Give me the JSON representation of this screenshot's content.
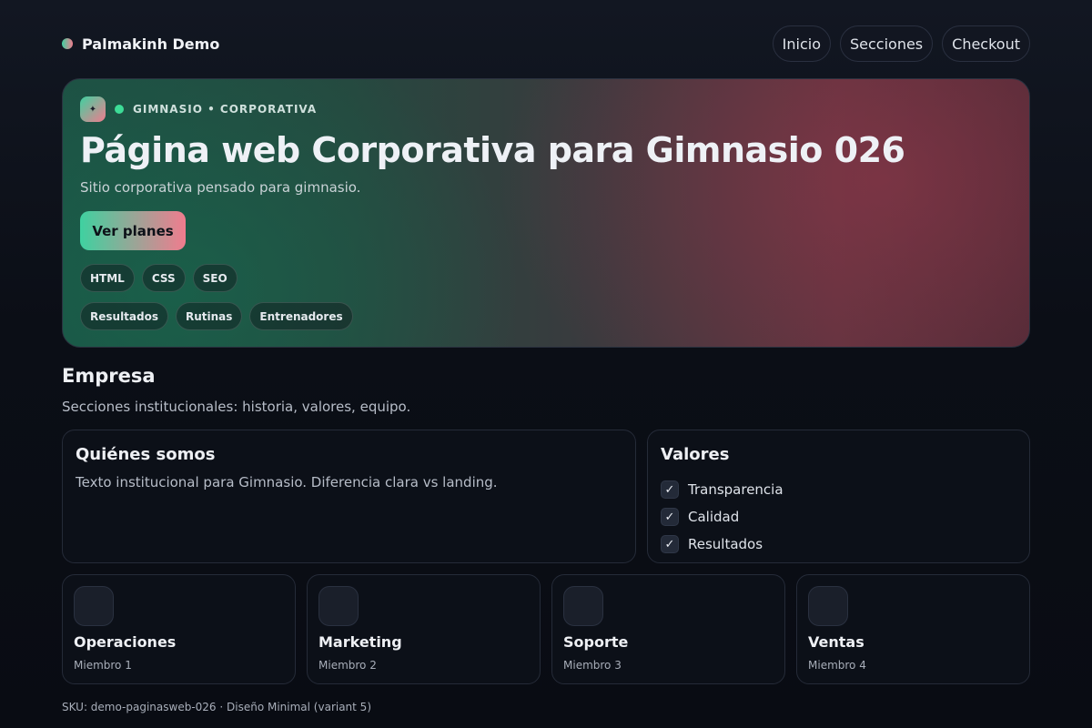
{
  "brand": {
    "name": "Palmakinh Demo"
  },
  "nav": {
    "items": [
      "Inicio",
      "Secciones",
      "Checkout"
    ]
  },
  "hero": {
    "logo_glyph": "✦",
    "kicker": "GIMNASIO • CORPORATIVA",
    "title": "Página web Corporativa para Gimnasio 026",
    "subtitle": "Sitio corporativa pensado para gimnasio.",
    "cta_label": "Ver planes",
    "tech_tags": [
      "HTML",
      "CSS",
      "SEO"
    ],
    "topic_tags": [
      "Resultados",
      "Rutinas",
      "Entrenadores"
    ]
  },
  "section": {
    "title": "Empresa",
    "subtitle": "Secciones institucionales: historia, valores, equipo."
  },
  "about": {
    "title": "Quiénes somos",
    "text": "Texto institucional para Gimnasio. Diferencia clara vs landing."
  },
  "values": {
    "title": "Valores",
    "check_glyph": "✓",
    "items": [
      "Transparencia",
      "Calidad",
      "Resultados"
    ]
  },
  "team": [
    {
      "area": "Operaciones",
      "member": "Miembro 1"
    },
    {
      "area": "Marketing",
      "member": "Miembro 2"
    },
    {
      "area": "Soporte",
      "member": "Miembro 3"
    },
    {
      "area": "Ventas",
      "member": "Miembro 4"
    }
  ],
  "footer": {
    "text": "SKU: demo-paginasweb-026 · Diseño Minimal (variant 5)"
  },
  "colors": {
    "accent_start": "#3fd1a0",
    "accent_end": "#f07c8e",
    "background": "#0b0e16",
    "status_dot": "#3ddc97"
  }
}
